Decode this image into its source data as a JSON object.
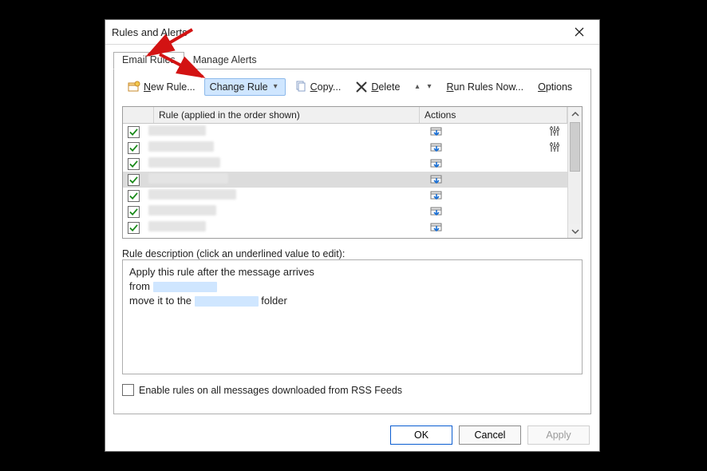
{
  "colors": {
    "accent": "#0a5dd1",
    "arrow": "#d31313"
  },
  "window": {
    "title": "Rules and Alerts"
  },
  "tabs": [
    {
      "label": "Email Rules",
      "active": true
    },
    {
      "label": "Manage Alerts",
      "active": false
    }
  ],
  "toolbar": {
    "new_rule": "New Rule...",
    "change_rule": "Change Rule",
    "copy": "Copy...",
    "delete": "Delete",
    "run_now": "Run Rules Now...",
    "options": "Options"
  },
  "grid": {
    "header": {
      "rule": "Rule (applied in the order shown)",
      "actions": "Actions"
    },
    "rows": [
      {
        "checked": true,
        "selected": false,
        "extra_icon": true
      },
      {
        "checked": true,
        "selected": false,
        "extra_icon": true
      },
      {
        "checked": true,
        "selected": false,
        "extra_icon": false
      },
      {
        "checked": true,
        "selected": true,
        "extra_icon": false
      },
      {
        "checked": true,
        "selected": false,
        "extra_icon": false
      },
      {
        "checked": true,
        "selected": false,
        "extra_icon": false
      },
      {
        "checked": true,
        "selected": false,
        "extra_icon": false
      }
    ]
  },
  "description": {
    "label": "Rule description (click an underlined value to edit):",
    "line1": "Apply this rule after the message arrives",
    "line2_pre": "from ",
    "line3_pre": "move it to the ",
    "line3_post": " folder"
  },
  "rss": {
    "label": "Enable rules on all messages downloaded from RSS Feeds",
    "checked": false
  },
  "buttons": {
    "ok": "OK",
    "cancel": "Cancel",
    "apply": "Apply"
  }
}
